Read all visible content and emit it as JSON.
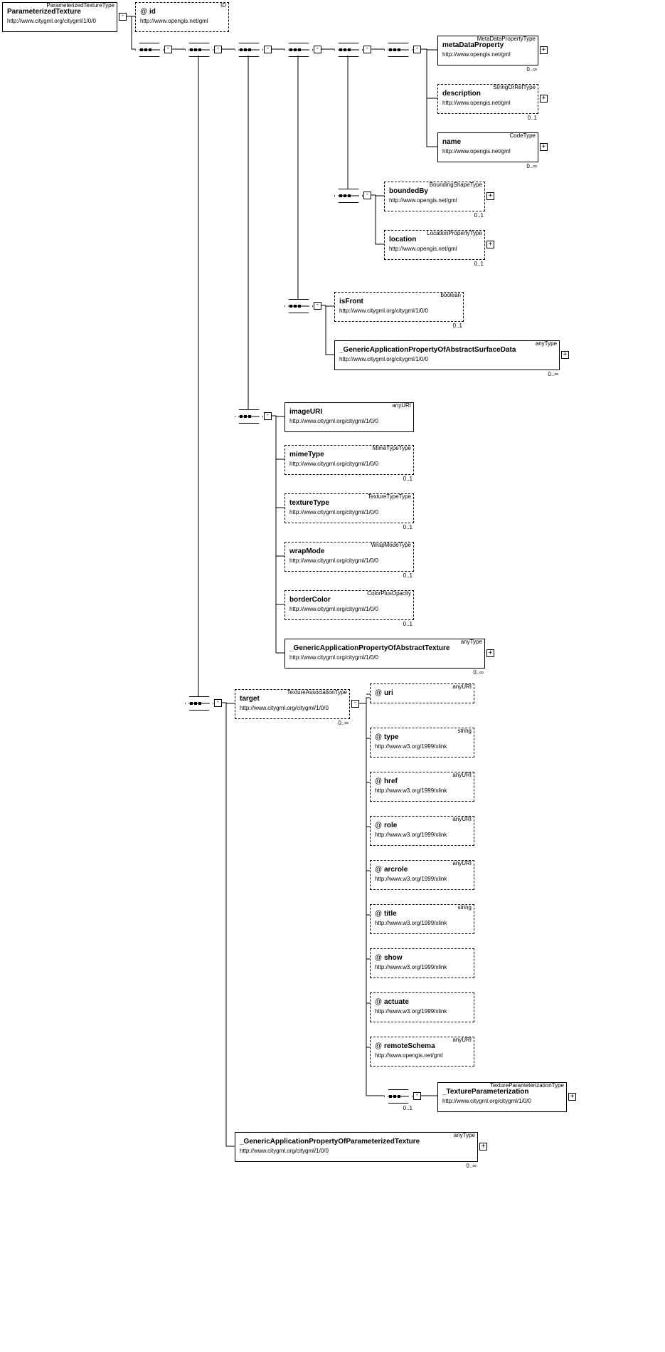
{
  "ns": {
    "citygml": "http://www.citygml.org/citygml/1/0/0",
    "gml": "http://www.opengis.net/gml",
    "xlink": "http://www.w3.org/1999/xlink"
  },
  "root": {
    "type": "ParameterizedTextureType",
    "name": "ParameterizedTexture"
  },
  "idAttr": {
    "type": "ID",
    "name": "id"
  },
  "gmlGroup": [
    {
      "type": "MetaDataPropertyType",
      "name": "metaDataProperty",
      "card": "0..∞"
    },
    {
      "type": "StringOrRefType",
      "name": "description",
      "card": "0..1"
    },
    {
      "type": "CodeType",
      "name": "name",
      "card": "0..∞"
    }
  ],
  "bounded": {
    "type": "BoundingShapeType",
    "name": "boundedBy",
    "card": "0..1"
  },
  "location": {
    "type": "LocationPropertyType",
    "name": "location",
    "card": "0..1"
  },
  "surface": [
    {
      "type": "boolean",
      "name": "isFront",
      "card": "0..1"
    },
    {
      "type": "anyType",
      "name": "_GenericApplicationPropertyOfAbstractSurfaceData",
      "card": "0..∞"
    }
  ],
  "texture": [
    {
      "type": "anyURI",
      "name": "imageURI",
      "card": ""
    },
    {
      "type": "MimeTypeType",
      "name": "mimeType",
      "card": "0..1"
    },
    {
      "type": "TextureTypeType",
      "name": "textureType",
      "card": "0..1"
    },
    {
      "type": "WrapModeType",
      "name": "wrapMode",
      "card": "0..1"
    },
    {
      "type": "ColorPlusOpacity",
      "name": "borderColor",
      "card": "0..1"
    },
    {
      "type": "anyType",
      "name": "_GenericApplicationPropertyOfAbstractTexture",
      "card": "0..∞"
    }
  ],
  "target": {
    "type": "TextureAssociationType",
    "name": "target",
    "card": "0..∞"
  },
  "targetAttrs": [
    {
      "type": "anyURI",
      "name": "uri",
      "ns": ""
    },
    {
      "type": "string",
      "name": "type",
      "ns": "xlink"
    },
    {
      "type": "anyURI",
      "name": "href",
      "ns": "xlink"
    },
    {
      "type": "anyURI",
      "name": "role",
      "ns": "xlink"
    },
    {
      "type": "anyURI",
      "name": "arcrole",
      "ns": "xlink"
    },
    {
      "type": "string",
      "name": "title",
      "ns": "xlink"
    },
    {
      "type": "",
      "name": "show",
      "ns": "xlink"
    },
    {
      "type": "",
      "name": "actuate",
      "ns": "xlink"
    },
    {
      "type": "anyURI",
      "name": "remoteSchema",
      "ns": "gml"
    }
  ],
  "texParam": {
    "type": "TextureParameterizationType",
    "name": "_TextureParameterization",
    "card": "0..1"
  },
  "generic": {
    "type": "anyType",
    "name": "_GenericApplicationPropertyOfParameterizedTexture",
    "card": "0..∞"
  }
}
